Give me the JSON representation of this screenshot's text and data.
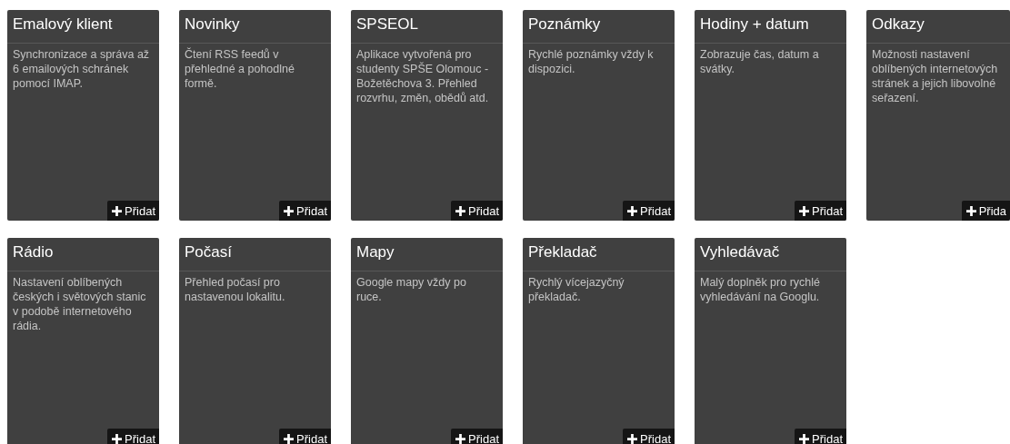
{
  "widgets": [
    {
      "title": "Emalový klient",
      "description": "Synchronizace a správa až 6 emailových schránek pomocí IMAP.",
      "button": "Přidat"
    },
    {
      "title": "Novinky",
      "description": "Čtení RSS feedů v přehledné a pohodlné formě.",
      "button": "Přidat"
    },
    {
      "title": "SPSEOL",
      "description": "Aplikace vytvořená pro studenty SPŠE Olomouc - Božetěchova 3. Přehled rozvrhu, změn, obědů atd.",
      "button": "Přidat"
    },
    {
      "title": "Poznámky",
      "description": "Rychlé poznámky vždy k dispozici.",
      "button": "Přidat"
    },
    {
      "title": "Hodiny + datum",
      "description": "Zobrazuje čas, datum a svátky.",
      "button": "Přidat"
    },
    {
      "title": "Odkazy",
      "description": "Možnosti nastavení oblíbených internetových stránek a jejich libovolné seřazení.",
      "button": "Přida"
    },
    {
      "title": "Rádio",
      "description": "Nastavení oblíbených českých i světových stanic v podobě internetového rádia.",
      "button": "Přidat"
    },
    {
      "title": "Počasí",
      "description": "Přehled počasí pro nastavenou lokalitu.",
      "button": "Přidat"
    },
    {
      "title": "Mapy",
      "description": "Google mapy vždy po ruce.",
      "button": "Přidat"
    },
    {
      "title": "Překladač",
      "description": "Rychlý vícejazyčný překladač.",
      "button": "Přidat"
    },
    {
      "title": "Vyhledávač",
      "description": "Malý doplněk pro rychlé vyhledávání na Googlu.",
      "button": "Přidat"
    }
  ]
}
